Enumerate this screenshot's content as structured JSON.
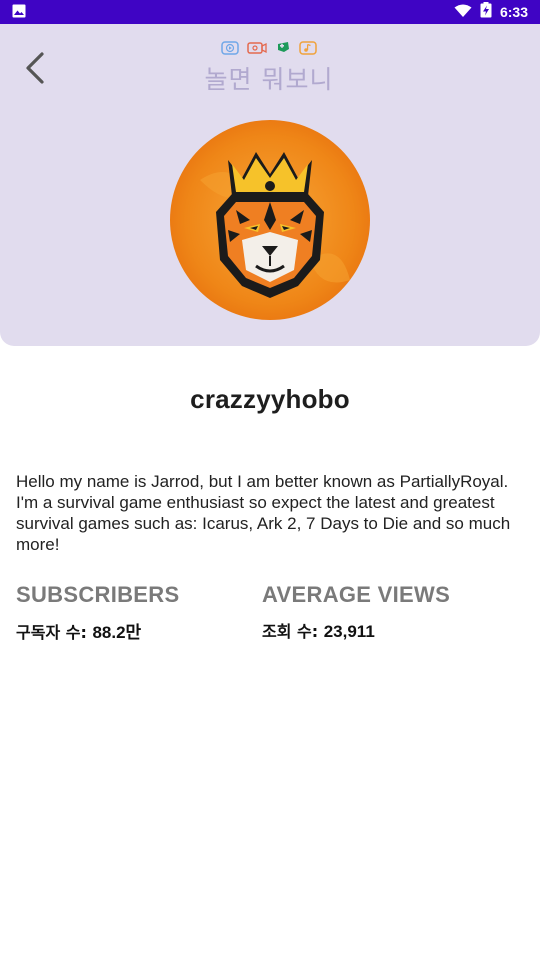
{
  "status_bar": {
    "time": "6:33",
    "icons": [
      "gallery-icon",
      "wifi-icon",
      "battery-charging-icon"
    ]
  },
  "header": {
    "logo_text": "놀면 뭐보니",
    "background": "#e1dcee"
  },
  "profile": {
    "username": "crazzyyhobo",
    "bio": "Hello my name is Jarrod, but I am better known as PartiallyRoyal. I'm a survival game enthusiast so expect the latest and greatest survival games such as: Icarus, Ark 2, 7 Days to Die and so much more!",
    "avatar": "tiger-crown-logo"
  },
  "stats": {
    "subscribers": {
      "title": "SUBSCRIBERS",
      "label": "구독자 수:",
      "value": "88.2만"
    },
    "average_views": {
      "title": "AVERAGE VIEWS",
      "label": "조회 수:",
      "value": "23,911"
    }
  },
  "colors": {
    "status_bar": "#3f04c4",
    "accent_orange": "#f08a1c",
    "stat_title": "#7a7a7a"
  }
}
